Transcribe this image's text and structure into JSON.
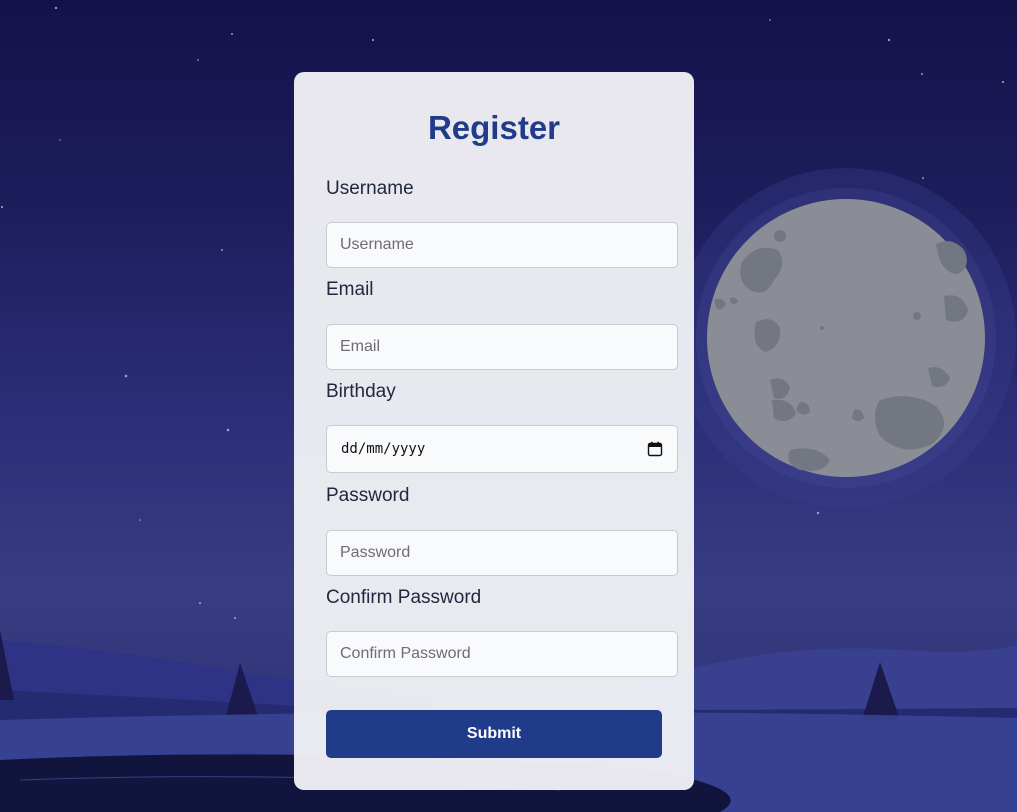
{
  "form": {
    "title": "Register",
    "fields": [
      {
        "label": "Username",
        "placeholder": "Username",
        "type": "text"
      },
      {
        "label": "Email",
        "placeholder": "Email",
        "type": "email"
      },
      {
        "label": "Birthday",
        "placeholder": "dd/mm/yyyy",
        "type": "date"
      },
      {
        "label": "Password",
        "placeholder": "Password",
        "type": "password"
      },
      {
        "label": "Confirm Password",
        "placeholder": "Confirm Password",
        "type": "password"
      }
    ],
    "submit_label": "Submit"
  },
  "icons": {
    "calendar": "calendar-icon"
  },
  "colors": {
    "accent": "#1f3b8a",
    "sky_top": "#14124a",
    "sky_bottom": "#383c82",
    "moon": "#8a8d95",
    "card_bg": "#f0f0f5"
  }
}
